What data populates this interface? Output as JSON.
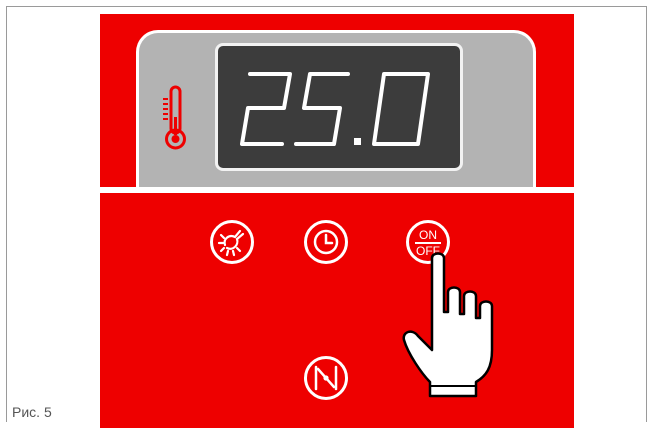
{
  "display": {
    "reading": "25.0"
  },
  "buttons": {
    "onoff_top": "ON",
    "onoff_bottom": "OFF"
  },
  "caption": "Рис. 5",
  "colors": {
    "panel": "#ee0000",
    "lcd_background": "#3c3c3c",
    "lcd_housing": "#b3b3b3",
    "foreground": "#ffffff"
  },
  "icons": [
    "thermometer-icon",
    "light-icon",
    "clock-icon",
    "on-off-icon",
    "damper-icon",
    "pointing-hand-icon"
  ]
}
